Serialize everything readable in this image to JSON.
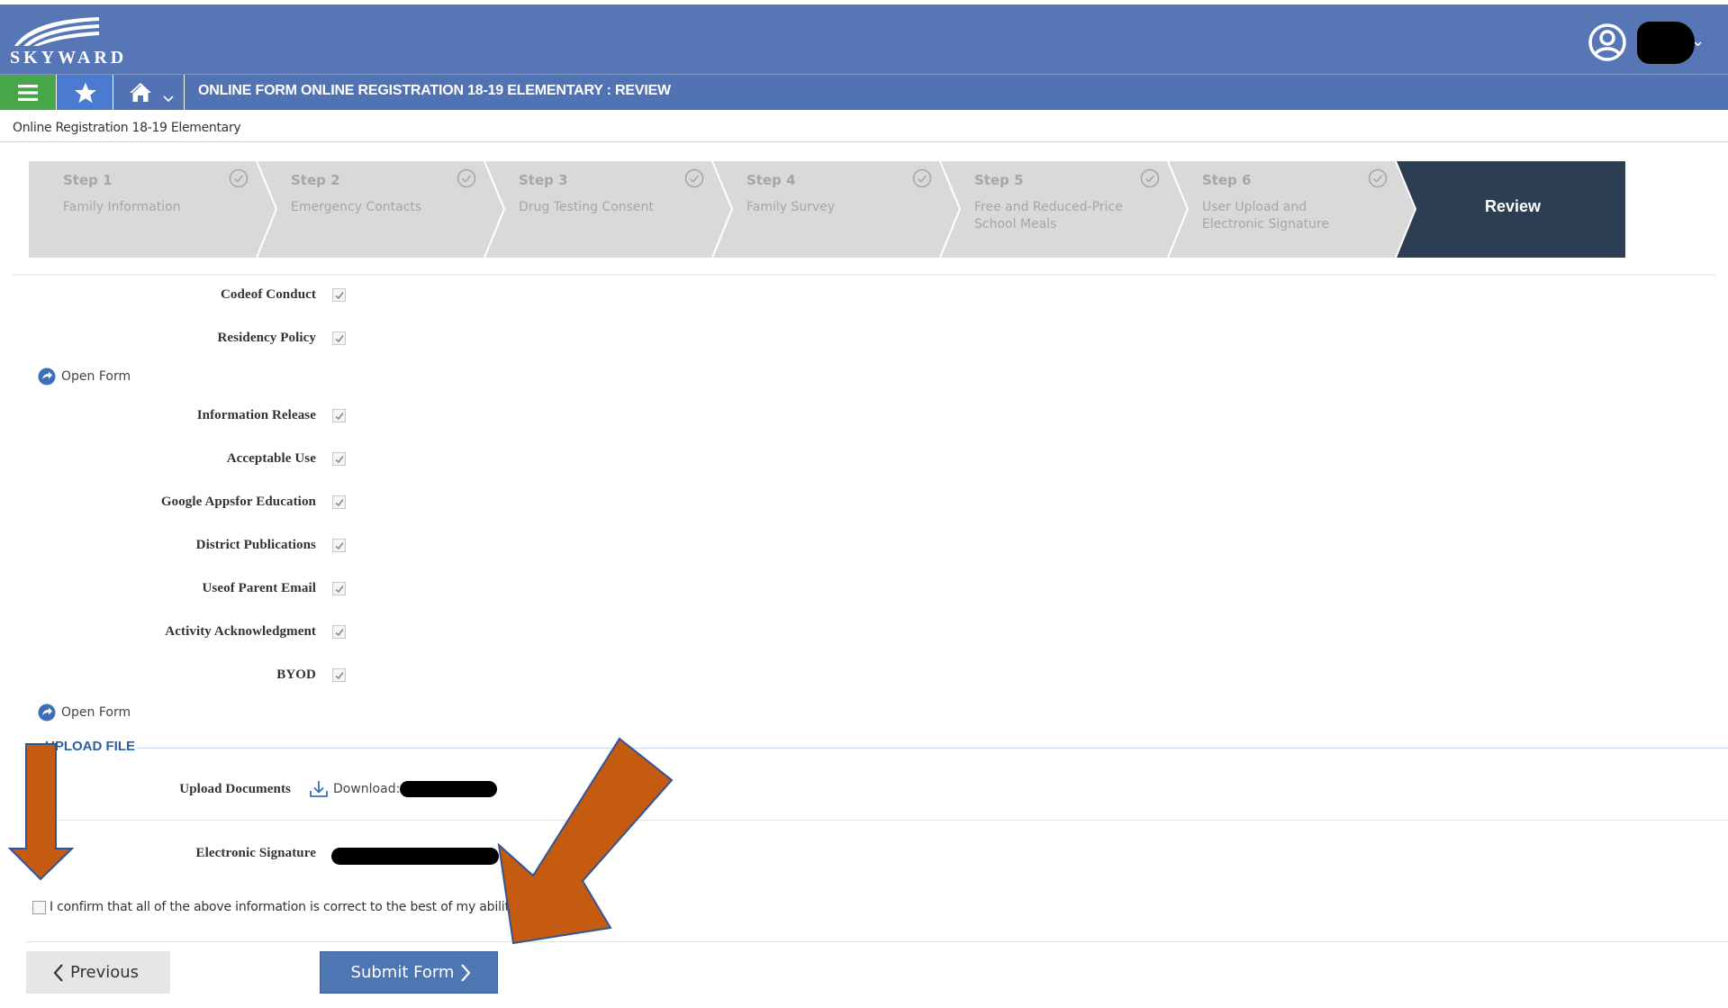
{
  "app": {
    "logo_text": "SKYWARD",
    "brand_color": "#5776b6",
    "accent_green": "#47a54a"
  },
  "navbar": {
    "menu_icon": "hamburger-icon",
    "favorite_icon": "star-icon",
    "home_icon": "home-icon",
    "title": "ONLINE FORM ONLINE REGISTRATION 18-19 ELEMENTARY : REVIEW"
  },
  "breadcrumb": "Online Registration 18-19 Elementary",
  "steps": [
    {
      "label": "Step 1",
      "desc": "Family Information",
      "status": "complete"
    },
    {
      "label": "Step 2",
      "desc": "Emergency Contacts",
      "status": "complete"
    },
    {
      "label": "Step 3",
      "desc": "Drug Testing Consent",
      "status": "complete"
    },
    {
      "label": "Step 4",
      "desc": "Family Survey",
      "status": "complete"
    },
    {
      "label": "Step 5",
      "desc": "Free and Reduced-Price School Meals",
      "status": "complete"
    },
    {
      "label": "Step 6",
      "desc": "User Upload and Electronic Signature",
      "status": "complete"
    },
    {
      "label": "Review",
      "desc": "",
      "status": "active"
    }
  ],
  "policies_group1": [
    {
      "label": "Codeof Conduct",
      "checked": true
    },
    {
      "label": "Residency Policy",
      "checked": true
    }
  ],
  "open_form_label": "Open Form",
  "policies_group2": [
    {
      "label": "Information Release",
      "checked": true
    },
    {
      "label": "Acceptable Use",
      "checked": true
    },
    {
      "label": "Google Appsfor Education",
      "checked": true
    },
    {
      "label": "District Publications",
      "checked": true
    },
    {
      "label": "Useof Parent Email",
      "checked": true
    },
    {
      "label": "Activity Acknowledgment",
      "checked": true
    },
    {
      "label": "BYOD",
      "checked": true
    }
  ],
  "upload": {
    "section_title": "UPLOAD FILE",
    "documents_label": "Upload Documents",
    "download_label": "Download:",
    "signature_label": "Electronic Signature"
  },
  "confirm": {
    "text": "I confirm that all of the above information is correct to the best of my ability",
    "checked": false
  },
  "buttons": {
    "previous": "Previous",
    "submit": "Submit Form"
  },
  "annotation_arrow_color": "#c55a11"
}
